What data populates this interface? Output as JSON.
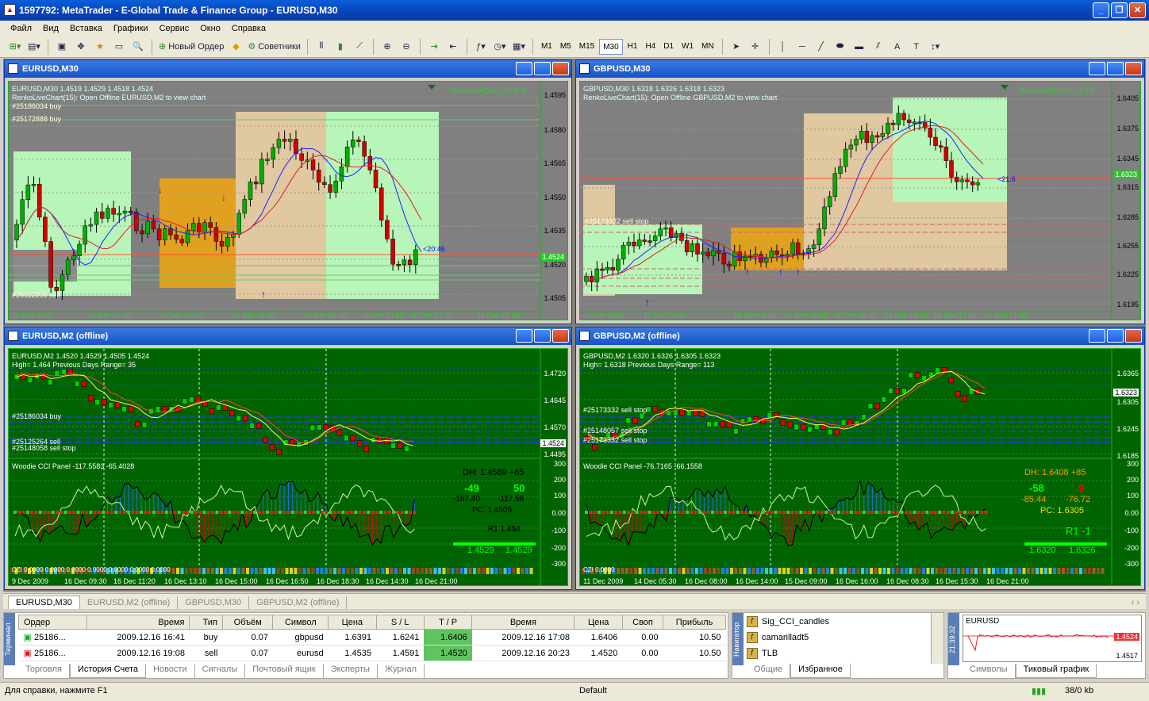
{
  "app": {
    "title": "1597792: MetaTrader - E-Global Trade & Finance Group - EURUSD,M30"
  },
  "menu": [
    "Файл",
    "Вид",
    "Вставка",
    "Графики",
    "Сервис",
    "Окно",
    "Справка"
  ],
  "toolbar": {
    "new_order": "Новый Ордер",
    "experts": "Советники",
    "timeframes": [
      "M1",
      "M5",
      "M15",
      "M30",
      "H1",
      "H4",
      "D1",
      "W1",
      "MN"
    ],
    "active_timeframe": "M30",
    "text_tool": "A",
    "label_tool": "T"
  },
  "windows": [
    {
      "id": "eurusd-m30",
      "title": "EURUSD,M30",
      "header": "EURUSD,M30  1.4519 1.4529 1.4518 1.4524",
      "info1": "RenkoLiveChart(15): Open Offline EURUSD,M2 to view chart",
      "info2": "#25186034 buy",
      "info3": "#25172888 buy",
      "info4": "#25112205 sell",
      "indicator_name": "RenkoLiveChart_v3.2 ©",
      "timer": "<20:46",
      "price_axis": [
        "1.4595",
        "1.4580",
        "1.4565",
        "1.4550",
        "1.4535",
        "1.4520",
        "1.4505"
      ],
      "current_price": "1.4524",
      "time_axis": [
        "15 Dec 2009",
        "15 Dec 21:30",
        "16 Dec 01:30",
        "16 Dec 05:30",
        "16 Dec 09:30",
        "16 Dec 13:30",
        "16 Dec 17:30",
        "16 Dec 21:30"
      ]
    },
    {
      "id": "gbpusd-m30",
      "title": "GBPUSD,M30",
      "header": "GBPUSD,M30  1.6318 1.6326 1.6318 1.6323",
      "info1": "RenkoLiveChart(15): Open Offline GBPUSD,M2 to view chart",
      "info2": "#25173332 sell stop",
      "indicator_name": "RenkoLiveChart_v3.2 ©",
      "timer": "<21:6",
      "price_axis": [
        "1.6405",
        "1.6375",
        "1.6345",
        "1.6315",
        "1.6285",
        "1.6255",
        "1.6225",
        "1.6195"
      ],
      "current_price": "1.6323",
      "time_axis": [
        "15 Dec 2009",
        "15 Dec 20:00",
        "16 Dec 01:30",
        "16 Dec 05:00",
        "16 Dec 08:00",
        "16 Dec 13:00",
        "16 Dec 17:00",
        "16 Dec 21:30"
      ]
    },
    {
      "id": "eurusd-m2",
      "title": "EURUSD,M2 (offline)",
      "header": "EURUSD,M2  1.4520 1.4529 1.4505 1.4524",
      "high_line": "High= 1.464     Previous Days Range= 35",
      "order1": "#25186034 buy",
      "order2": "#25125264 sell",
      "order3": "#25148058 sell stop",
      "price_axis": [
        "1.4720",
        "1.4645",
        "1.4570",
        "1.4495"
      ],
      "current_price": "1.4524",
      "cci_title": "Woodie CCI Panel -117.5583 -65.4028",
      "cci_dh": "DH: 1.4589 +65",
      "cci_val1": "-49",
      "cci_val2": "50",
      "cci_sub1": "-167.40",
      "cci_sub2": "-117.56",
      "cci_pc": "PC: 1.4505",
      "cci_r": "R1 1.454",
      "cci_price1": "1.4529",
      "cci_price2": "1.4529",
      "cci_axis": [
        "300",
        "200",
        "100",
        "0.00",
        "-100",
        "-200",
        "-300"
      ],
      "cci_foot": "CZI 0.0000 0.0000 0.0000 0.0000 0.0000 0.0000 0.0000",
      "time_axis": [
        "9 Dec 2009",
        "16 Dec 09:30",
        "16 Dec 11:20",
        "16 Dec 13:10",
        "16 Dec 15:00",
        "16 Dec 16:50",
        "16 Dec 18:30",
        "16 Dec 14:30",
        "16 Dec 21:00"
      ]
    },
    {
      "id": "gbpusd-m2",
      "title": "GBPUSD,M2 (offline)",
      "header": "GBPUSD,M2  1.6320 1.6326 1.6305 1.6323",
      "high_line": "High= 1.6318     Previous Days Range= 113",
      "order1": "#25173332 sell stop",
      "order2": "#25148057 sell stop",
      "order3": "#25173332 sell stop",
      "price_axis": [
        "1.6365",
        "1.6305",
        "1.6245",
        "1.6185"
      ],
      "current_price": "1.6323",
      "cci_title": "Woodie CCI Panel -76.7165 -66.1558",
      "cci_dh": "DH: 1.6408 +85",
      "cci_val1": "-58",
      "cci_val2": "9",
      "cci_sub1": "-85.44",
      "cci_sub2": "-76.72",
      "cci_pc": "PC: 1.6305",
      "cci_r": "R1 -1",
      "cci_price1": "1.6320",
      "cci_price2": "1.6326",
      "cci_axis": [
        "300",
        "200",
        "100",
        "0.00",
        "-100",
        "-200",
        "-300"
      ],
      "cci_foot": "CZI 0.0000",
      "time_axis": [
        "11 Dec 2009",
        "14 Dec 05:30",
        "16 Dec 08:00",
        "16 Dec 14:00",
        "15 Dec 09:00",
        "16 Dec 16:00",
        "16 Dec 08:30",
        "16 Dec 15:30",
        "16 Dec 21:00"
      ]
    }
  ],
  "doc_tabs": [
    "EURUSD,M30",
    "EURUSD,M2 (offline)",
    "GBPUSD,M30",
    "GBPUSD,M2 (offline)"
  ],
  "active_doc_tab": "EURUSD,M30",
  "terminal": {
    "side_label": "Терминал",
    "columns": [
      "Ордер",
      "Время",
      "Тип",
      "Объём",
      "Символ",
      "Цена",
      "S / L",
      "T / P",
      "Время",
      "Цена",
      "Своп",
      "Прибыль"
    ],
    "rows": [
      [
        "25186...",
        "2009.12.16 16:41",
        "buy",
        "0.07",
        "gbpusd",
        "1.6391",
        "1.6241",
        "1.6406",
        "2009.12.16 17:08",
        "1.6406",
        "0.00",
        "10.50"
      ],
      [
        "25186...",
        "2009.12.16 19:08",
        "sell",
        "0.07",
        "eurusd",
        "1.4535",
        "1.4591",
        "1.4520",
        "2009.12.16 20:23",
        "1.4520",
        "0.00",
        "10.50"
      ]
    ],
    "tabs": [
      "Торговля",
      "История Счета",
      "Новости",
      "Сигналы",
      "Почтовый ящик",
      "Эксперты",
      "Журнал"
    ],
    "active_tab": "История Счета"
  },
  "navigator": {
    "side_label": "Навигатор",
    "items": [
      "Sig_CCI_candles",
      "camarilladt5",
      "TLB"
    ],
    "tabs": [
      "Общие",
      "Избранное"
    ],
    "active_tab": "Избранное"
  },
  "ticks": {
    "side_label": "21:39:32",
    "symbol": "EURUSD",
    "price_hi": "1.4524",
    "price_lo": "1.4517",
    "tabs": [
      "Символы",
      "Тиковый график"
    ],
    "active_tab": "Тиковый график"
  },
  "status": {
    "help": "Для справки, нажмите F1",
    "profile": "Default",
    "traffic": "38/0 kb"
  },
  "colors": {
    "chart_bg": "#808080",
    "renko_bg": "#006400",
    "bull_candle": "#00a000",
    "bear_candle": "#c00000",
    "box_green": "#b8f5b8",
    "box_tan": "#e0c8a0",
    "box_orange": "#e0a020"
  }
}
